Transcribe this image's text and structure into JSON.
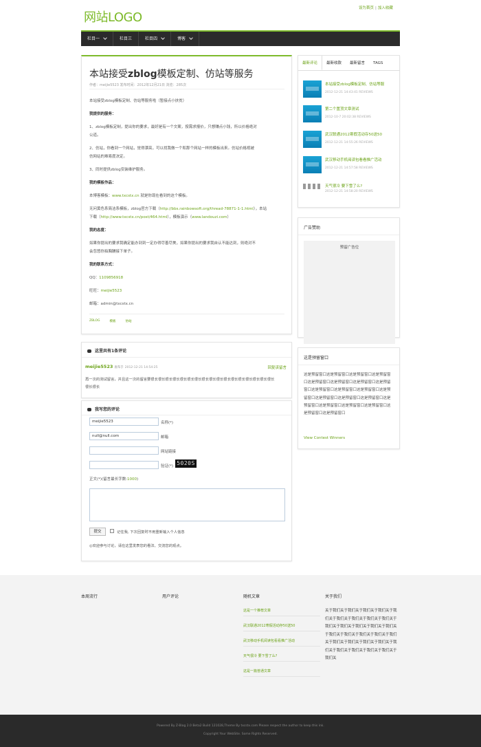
{
  "header": {
    "logo": "网站LOGO",
    "set_home": "设为首页",
    "sep": "|",
    "add_fav": "加入收藏"
  },
  "nav": [
    {
      "label": "栏目一",
      "dropdown": true
    },
    {
      "label": "栏目三",
      "dropdown": false
    },
    {
      "label": "栏目四",
      "dropdown": true
    },
    {
      "label": "博客",
      "dropdown": true
    }
  ],
  "post": {
    "title_a": "本站接受",
    "title_b": "zblog",
    "title_c": "模板定制、仿站等服务",
    "meta": "作者：meijie5523   发布时间：2012年12月21日   浏览：285次",
    "p1": "本站接受zblog模板定制、仿站等服务啦（暂接点小扶贫）",
    "p2": "我提供的服务：",
    "p3": "1、zblog模板定制，提出你的要求，最好是有一个文案，按需求报价，只想赚点小钱，所以价格绝对",
    "p3b": "公道。",
    "p4": "2、仿站，你看到一个网站，觉得漂亮，可以找我做一个和那个网站一样的模板出来。仿站价格视被",
    "p4b": "仿网站的难易度决定。",
    "p5": "3、同时提供zblog安装维护服务。",
    "p6": "我的模板作品：",
    "p7a": "本博客模板：",
    "p7b": "www.txcstx.cn",
    "p7c": "就是你现在看到的这个模板。",
    "p8a": "无问黄色系简洁系模板，zblog官方下载（",
    "p8b": "http://bbs.rainbowsoft.org/thread-78871-1-1.html",
    "p8c": "），本站",
    "p8d": "下载（",
    "p8e": "http://www.txcstx.cn/post/464.html",
    "p8f": "），模板演示（",
    "p8g": "www.landouzi.com",
    "p8h": "）",
    "p9": "我的态度：",
    "p10": "如果你提出的要求我确定能办到到一定办得尽善尽美，如果你提出的要求我自认不能达到，则绝对不",
    "p10b": "会忽悠你拍胸脯接下单子。",
    "p11": "我的联系方式：",
    "qq_label": "QQ：",
    "qq": "1109856918",
    "ww_label": "旺旺：",
    "ww": "meijie5523",
    "mail_label": "邮箱：",
    "mail": "admin@txcstx.cn",
    "tags": [
      "ZBLOG",
      "模板",
      "仿站"
    ]
  },
  "comments": {
    "title": "这里共有1条评论",
    "author": "meijie5523",
    "tag": "发布于",
    "date": "2012-12-21 14:54:25",
    "reply": "回复该留言",
    "text1": "再一次的测试留言，并且这一次的留言要很长很长很长很长很长很长很长很长很长很长很长很长很长很长很长很长很长",
    "text2": "很长很长"
  },
  "form": {
    "title": "我写您的评论",
    "name_value": "meijie5523",
    "name_label": "名称(*)",
    "email_value": "null@null.com",
    "email_label": "邮箱",
    "url_label": "网站链接",
    "captcha_label": "验证(*)",
    "captcha_code": "5020S",
    "body_label": "正文(*)(留言最长字数:",
    "body_max": "1000",
    "body_close": ")",
    "submit": "提交",
    "remember": "记住我, 下次回复时不用重新输入个人信息",
    "note": "◎欢迎参与讨论，请在这里发表您的看法、交流您的观点。"
  },
  "sidebar": {
    "tabs": [
      "最新评论",
      "最新收款",
      "最新留言",
      "TAGS"
    ],
    "news": [
      {
        "title": "本站接受zblog模板定制、仿站等服",
        "date": "2012-12-21 14:43:41 REVIEWS"
      },
      {
        "title": "第二个置顶文章测试",
        "date": "2012-10-7 20:02:38 REVIEWS"
      },
      {
        "title": "武汉联通2012寒假活动存50送50",
        "date": "2012-12-21 14:55:26 REVIEWS"
      },
      {
        "title": "武汉移动手机阅读包看看推广活动",
        "date": "2012-12-21 14:57:58 REVIEWS"
      },
      {
        "title": "天气很冷 要下雪了么?",
        "date": "2012-12-21 14:58:20 REVIEWS"
      }
    ],
    "ad_title": "广告赞助",
    "ad_placeholder": "预留广告位",
    "widget_title": "这是预留窗口",
    "widget_text": "这是预留窗口这是预留窗口这是预留窗口这是预留窗口这是预留窗口这是预留窗口这是预留窗口这是预留窗口这是预留窗口这是预留窗口这是预留窗口这是预留窗口这是预留窗口这是预留窗口这是预留窗口这是预留窗口这是预留窗口这是预留窗口这是预留窗口这是预留窗口这是预留窗口",
    "widget_link": "View Contest Winners"
  },
  "footer": {
    "col1": "本周流行",
    "col2": "用户评论",
    "col3": "随机文章",
    "col4": "关于我们",
    "random": [
      "这是一个推荐文章",
      "武汉联通2012寒假活动存50送50",
      "武汉移动手机阅读包看看推广活动",
      "天气很冷 要下雪了么?",
      "这是一篇普通文章"
    ],
    "about": "关于我们关于我们关于我们关于我们关于我们关于我们关于我们关于我们关于我们关于我们关于我们关于我们关于我们关于我们关于我们关于我们关于我们关于我们关于我们关于我们关于我们关于我们关于我们关于我们关于我们关于我们关于我们关于我们关于我们关",
    "powered": "Powered By Z-Blog 2.0 Beta2 Build 121028,Theme By txcstx.com Please respect the author to keep this ink.",
    "copyright": "Copyright Your WebSite. Some Rights Reserved."
  }
}
